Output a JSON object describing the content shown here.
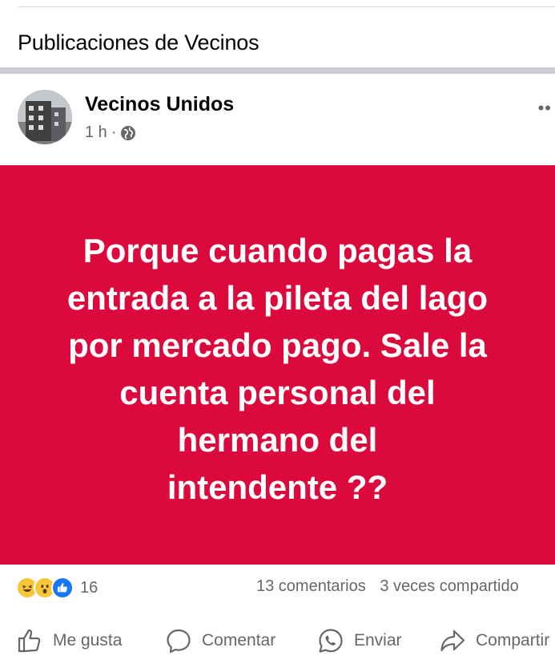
{
  "section": {
    "title": "Publicaciones de Vecinos"
  },
  "post": {
    "author": "Vecinos Unidos",
    "time": "1 h",
    "separator": "·",
    "privacy_icon": "globe-icon",
    "more_label": "••",
    "text": "Porque cuando pagas la\nentrada a la pileta del lago\npor mercado pago. Sale la\ncuenta personal del\nhermano del\nintendente ??",
    "background_color": "#dc0a3c"
  },
  "stats": {
    "reaction_icons": [
      "haha-icon",
      "wow-icon",
      "like-icon"
    ],
    "reaction_count": "16",
    "comments": "13 comentarios",
    "shares": "3 veces compartido"
  },
  "actions": {
    "like": "Me gusta",
    "comment": "Comentar",
    "send": "Enviar",
    "share": "Compartir"
  },
  "colors": {
    "secondary_text": "#65676b",
    "divider": "#c9ccd1",
    "like_blue": "#1877f2"
  }
}
